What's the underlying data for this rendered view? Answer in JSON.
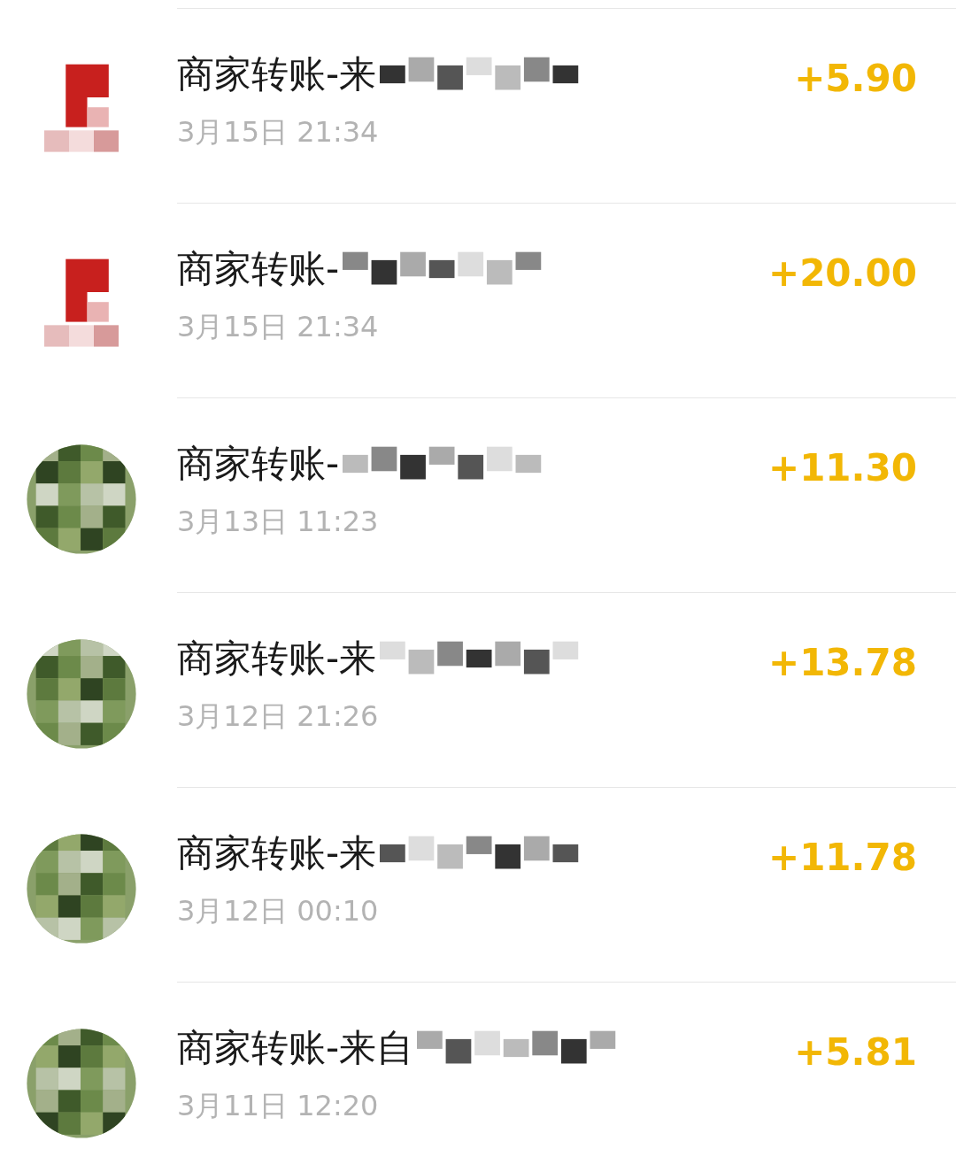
{
  "transactions": [
    {
      "avatar": {
        "kind": "red"
      },
      "title": "商家转账-来",
      "date": "3月15日 21:34",
      "amount": "+5.90"
    },
    {
      "avatar": {
        "kind": "red"
      },
      "title": "商家转账-",
      "date": "3月15日 21:34",
      "amount": "+20.00"
    },
    {
      "avatar": {
        "kind": "green"
      },
      "title": "商家转账-",
      "date": "3月13日 11:23",
      "amount": "+11.30"
    },
    {
      "avatar": {
        "kind": "green"
      },
      "title": "商家转账-来",
      "date": "3月12日 21:26",
      "amount": "+13.78"
    },
    {
      "avatar": {
        "kind": "green"
      },
      "title": "商家转账-来",
      "date": "3月12日 00:10",
      "amount": "+11.78"
    },
    {
      "avatar": {
        "kind": "green"
      },
      "title": "商家转账-来自",
      "date": "3月11日 12:20",
      "amount": "+5.81"
    }
  ]
}
